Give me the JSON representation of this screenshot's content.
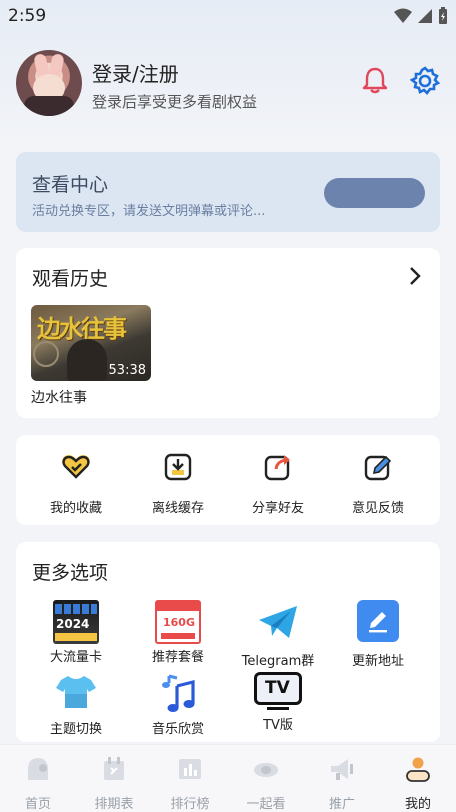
{
  "status": {
    "time": "2:59"
  },
  "profile": {
    "title": "登录/注册",
    "subtitle": "登录后享受更多看剧权益"
  },
  "center": {
    "title": "查看中心",
    "subtitle": "活动兑换专区，请发送文明弹幕或评论..."
  },
  "history": {
    "title": "观看历史",
    "items": [
      {
        "poster_text": "边水往事",
        "duration": "53:38",
        "label": "边水往事"
      }
    ]
  },
  "actions": [
    {
      "label": "我的收藏",
      "icon": "heart-icon"
    },
    {
      "label": "离线缓存",
      "icon": "download-icon"
    },
    {
      "label": "分享好友",
      "icon": "share-icon"
    },
    {
      "label": "意见反馈",
      "icon": "feedback-icon"
    }
  ],
  "more": {
    "title": "更多选项",
    "options": [
      {
        "label": "大流量卡",
        "icon": "data-card-icon",
        "badge": "2024"
      },
      {
        "label": "推荐套餐",
        "icon": "plan-icon",
        "badge": "160G"
      },
      {
        "label": "Telegram群",
        "icon": "telegram-icon"
      },
      {
        "label": "更新地址",
        "icon": "edit-icon"
      },
      {
        "label": "主题切换",
        "icon": "tshirt-icon"
      },
      {
        "label": "音乐欣赏",
        "icon": "music-icon"
      },
      {
        "label": "TV版",
        "icon": "tv-icon",
        "badge": "TV"
      }
    ]
  },
  "tabs": [
    {
      "label": "首页",
      "icon": "home-icon",
      "active": false
    },
    {
      "label": "排期表",
      "icon": "calendar-icon",
      "active": false
    },
    {
      "label": "排行榜",
      "icon": "chart-icon",
      "active": false
    },
    {
      "label": "一起看",
      "icon": "eye-icon",
      "active": false
    },
    {
      "label": "推广",
      "icon": "megaphone-icon",
      "active": false
    },
    {
      "label": "我的",
      "icon": "user-icon",
      "active": true
    }
  ],
  "colors": {
    "accent": "#1e6fd9",
    "center_bg": "#dce6f3",
    "center_button": "#6b83ad",
    "bell": "#e0475a",
    "active_tab": "#f0a24a"
  }
}
